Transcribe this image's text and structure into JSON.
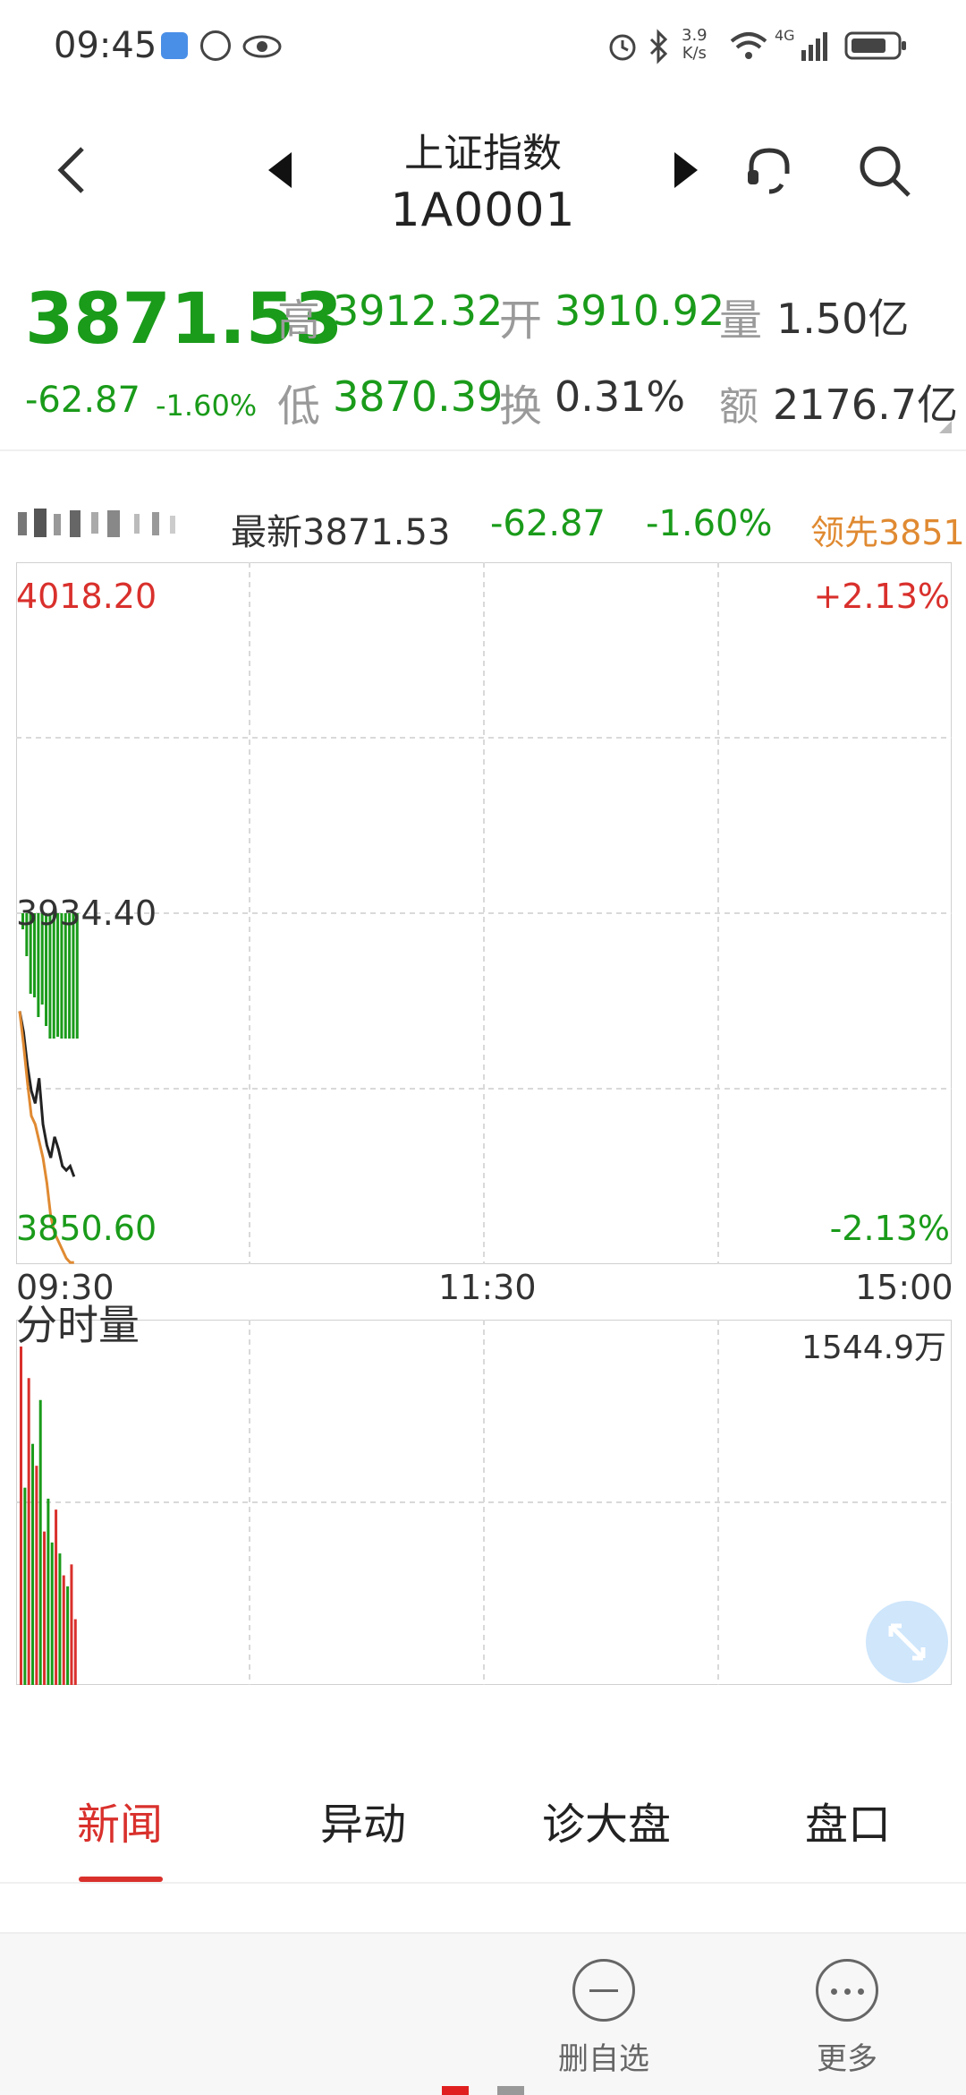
{
  "status_bar": {
    "time": "09:45",
    "network_speed_top": "3.9",
    "network_speed_unit": "K/s",
    "network_type": "4G",
    "icons": [
      "alarm-icon",
      "bluetooth-icon",
      "wifi-icon",
      "signal-icon",
      "battery-icon"
    ]
  },
  "header": {
    "title": "上证指数",
    "code": "1A0001"
  },
  "quote": {
    "price": "3871.53",
    "change": "-62.87",
    "change_pct": "-1.60%",
    "high_label": "高",
    "high": "3912.32",
    "open_label": "开",
    "open": "3910.92",
    "volume_label": "量",
    "volume": "1.50亿",
    "low_label": "低",
    "low": "3870.39",
    "turnover_label": "换",
    "turnover": "0.31%",
    "amount_label": "额",
    "amount": "2176.7亿"
  },
  "legend": {
    "latest_label": "最新",
    "latest": "3871.53",
    "change": "-62.87",
    "change_pct": "-1.60%",
    "leader_label": "领先",
    "leader": "3851"
  },
  "chart": {
    "y_top": "4018.20",
    "y_top_pct": "+2.13%",
    "y_mid": "3934.40",
    "y_bottom": "3850.60",
    "y_bottom_pct": "-2.13%",
    "x_start": "09:30",
    "x_mid": "11:30",
    "x_end": "15:00",
    "volume_title": "分时量",
    "volume_max": "1544.9万"
  },
  "chart_data": {
    "type": "line",
    "ylim": [
      3850.6,
      4018.2
    ],
    "series": [
      {
        "values": [
          3911,
          3906,
          3898,
          3892,
          3889,
          3895,
          3884,
          3879,
          3876,
          3881,
          3878,
          3874,
          3873,
          3874,
          3871.5
        ]
      },
      {
        "values": [
          3911,
          3903,
          3894,
          3886,
          3884,
          3880,
          3876,
          3870,
          3862,
          3858,
          3856,
          3854,
          3852,
          3851,
          3851
        ]
      }
    ],
    "volume": [
      1544,
      900,
      1400,
      1100,
      1000,
      1300,
      700,
      850,
      650,
      800,
      600,
      500,
      450,
      550,
      300
    ],
    "volume_colors": [
      "red",
      "green",
      "red",
      "green",
      "red",
      "green",
      "red",
      "green",
      "green",
      "red",
      "green",
      "red",
      "green",
      "red",
      "red"
    ]
  },
  "tabs": [
    {
      "label": "新闻",
      "active": true
    },
    {
      "label": "异动",
      "active": false
    },
    {
      "label": "诊大盘",
      "active": false
    },
    {
      "label": "盘口",
      "active": false
    }
  ],
  "bottom": {
    "remove_label": "删自选",
    "more_label": "更多"
  },
  "colors": {
    "up": "#d9302c",
    "down": "#1a9b1a",
    "avg_line": "#e08a32",
    "price_line": "#222222"
  }
}
